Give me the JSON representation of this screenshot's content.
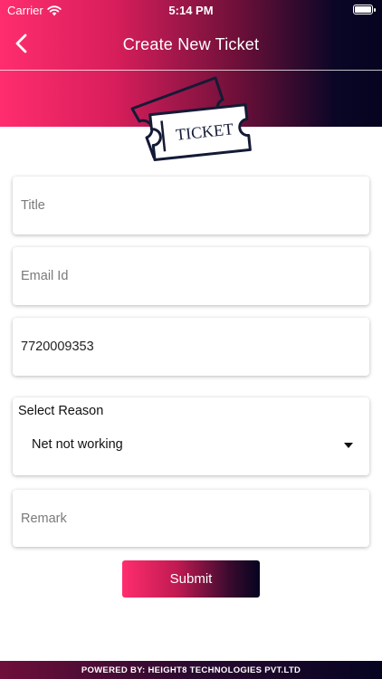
{
  "status_bar": {
    "carrier": "Carrier",
    "time": "5:14 PM"
  },
  "nav": {
    "title": "Create New Ticket",
    "back_icon": "chevron-left-icon"
  },
  "logo": {
    "text": "TICKET",
    "icon": "ticket-icon"
  },
  "form": {
    "title_placeholder": "Title",
    "email_placeholder": "Email Id",
    "phone_value": "7720009353",
    "reason_label": "Select Reason",
    "reason_selected": "Net not working",
    "remark_placeholder": "Remark",
    "submit_label": "Submit"
  },
  "footer": {
    "text": "POWERED BY: HEIGHT8 TECHNOLOGIES PVT.LTD"
  },
  "colors": {
    "accent_pink": "#ff2d6e",
    "accent_navy": "#050420"
  }
}
